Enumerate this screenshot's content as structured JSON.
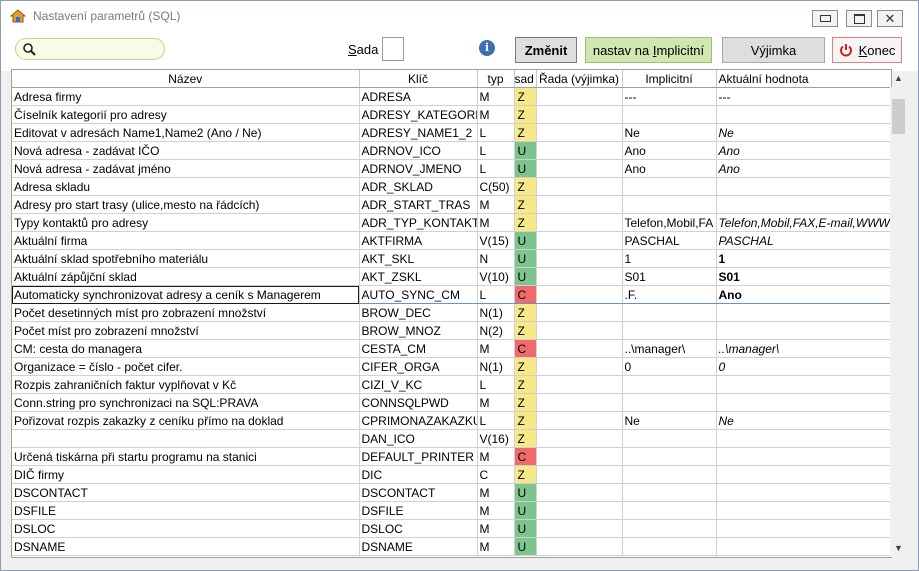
{
  "window": {
    "title": "Nastavení parametrů (SQL)"
  },
  "toolbar": {
    "search_value": "",
    "sada_label_pre": "",
    "sada_label_u": "S",
    "sada_label_post": "ada",
    "sada_value": "",
    "zmenit": "Změnit",
    "implicitni_pre": "nastav na ",
    "implicitni_u": "I",
    "implicitni_post": "mplicitní",
    "vyjimka": "Výjimka",
    "konec_u": "K",
    "konec_post": "onec"
  },
  "colors": {
    "Z": "#f7e98a",
    "U": "#7ec48e",
    "C": "#f06a6a"
  },
  "columns": [
    "Název",
    "Klíč",
    "typ",
    "sad",
    "Řada (výjimka)",
    "Implicitní",
    "Aktuální hodnota"
  ],
  "rows": [
    {
      "nazev": "Adresa firmy",
      "klic": "ADRESA",
      "typ": "M",
      "sad": "Z",
      "rada": "",
      "impl": "---",
      "akt": "---",
      "akt_style": ""
    },
    {
      "nazev": "Číselník kategorií pro adresy",
      "klic": "ADRESY_KATEGORI",
      "typ": "M",
      "sad": "Z",
      "rada": "",
      "impl": "",
      "akt": "",
      "akt_style": ""
    },
    {
      "nazev": "Editovat v adresách Name1,Name2 (Ano / Ne)",
      "klic": "ADRESY_NAME1_2",
      "typ": "L",
      "sad": "Z",
      "rada": "",
      "impl": "Ne",
      "akt": "Ne",
      "akt_style": "it"
    },
    {
      "nazev": "Nová adresa - zadávat IČO",
      "klic": "ADRNOV_ICO",
      "typ": "L",
      "sad": "U",
      "rada": "",
      "impl": "Ano",
      "akt": "Ano",
      "akt_style": "it"
    },
    {
      "nazev": "Nová adresa - zadávat jméno",
      "klic": "ADRNOV_JMENO",
      "typ": "L",
      "sad": "U",
      "rada": "",
      "impl": "Ano",
      "akt": "Ano",
      "akt_style": "it"
    },
    {
      "nazev": "Adresa skladu",
      "klic": "ADR_SKLAD",
      "typ": "C(50)",
      "sad": "Z",
      "rada": "",
      "impl": "",
      "akt": "",
      "akt_style": ""
    },
    {
      "nazev": "Adresy pro start trasy (ulice,mesto na řádcích)",
      "klic": "ADR_START_TRAS",
      "typ": "M",
      "sad": "Z",
      "rada": "",
      "impl": "",
      "akt": "",
      "akt_style": ""
    },
    {
      "nazev": "Typy kontaktů pro adresy",
      "klic": "ADR_TYP_KONTAKT",
      "typ": "M",
      "sad": "Z",
      "rada": "",
      "impl": "Telefon,Mobil,FA",
      "akt": "Telefon,Mobil,FAX,E-mail,WWW",
      "akt_style": "it"
    },
    {
      "nazev": "Aktuální firma",
      "klic": "AKTFIRMA",
      "typ": "V(15)",
      "sad": "U",
      "rada": "",
      "impl": "PASCHAL",
      "akt": "PASCHAL",
      "akt_style": "it"
    },
    {
      "nazev": "Aktuální sklad spotřebního materiálu",
      "klic": "AKT_SKL",
      "typ": "N",
      "sad": "U",
      "rada": "",
      "impl": "1",
      "akt": "1",
      "akt_style": "b"
    },
    {
      "nazev": "Aktuální zápůjční sklad",
      "klic": "AKT_ZSKL",
      "typ": "V(10)",
      "sad": "U",
      "rada": "",
      "impl": "S01",
      "akt": "S01",
      "akt_style": "b"
    },
    {
      "nazev": "Automaticky synchronizovat adresy a ceník s Managerem",
      "klic": "AUTO_SYNC_CM",
      "typ": "L",
      "sad": "C",
      "rada": "",
      "impl": ".F.",
      "akt": "Ano",
      "akt_style": "b",
      "selected": true
    },
    {
      "nazev": "Počet desetinných míst pro zobrazení množství",
      "klic": "BROW_DEC",
      "typ": "N(1)",
      "sad": "Z",
      "rada": "",
      "impl": "",
      "akt": "",
      "akt_style": ""
    },
    {
      "nazev": "Počet míst pro zobrazení množství",
      "klic": "BROW_MNOZ",
      "typ": "N(2)",
      "sad": "Z",
      "rada": "",
      "impl": "",
      "akt": "",
      "akt_style": ""
    },
    {
      "nazev": "CM: cesta do managera",
      "klic": "CESTA_CM",
      "typ": "M",
      "sad": "C",
      "rada": "",
      "impl": "..\\manager\\",
      "akt": "..\\manager\\",
      "akt_style": "it"
    },
    {
      "nazev": "Organizace = číslo - počet cifer.",
      "klic": "CIFER_ORGA",
      "typ": "N(1)",
      "sad": "Z",
      "rada": "",
      "impl": "0",
      "akt": "0",
      "akt_style": "it"
    },
    {
      "nazev": "Rozpis zahraničních faktur vyplňovat v Kč",
      "klic": "CIZI_V_KC",
      "typ": "L",
      "sad": "Z",
      "rada": "",
      "impl": "",
      "akt": "",
      "akt_style": ""
    },
    {
      "nazev": "Conn.string pro synchronizaci na SQL:PRAVA",
      "klic": "CONNSQLPWD",
      "typ": "M",
      "sad": "Z",
      "rada": "",
      "impl": "",
      "akt": "",
      "akt_style": ""
    },
    {
      "nazev": "Pořizovat rozpis zakazky z ceníku přímo na doklad",
      "klic": "CPRIMONAZAKAZKU",
      "typ": "L",
      "sad": "Z",
      "rada": "",
      "impl": "Ne",
      "akt": "Ne",
      "akt_style": "it"
    },
    {
      "nazev": "",
      "klic": "DAN_ICO",
      "typ": "V(16)",
      "sad": "Z",
      "rada": "",
      "impl": "",
      "akt": "",
      "akt_style": ""
    },
    {
      "nazev": "Určená tiskárna při startu programu na stanici",
      "klic": "DEFAULT_PRINTER",
      "typ": "M",
      "sad": "C",
      "rada": "",
      "impl": "",
      "akt": "",
      "akt_style": ""
    },
    {
      "nazev": "DIČ firmy",
      "klic": "DIC",
      "typ": "C",
      "sad": "Z",
      "rada": "",
      "impl": "",
      "akt": "",
      "akt_style": ""
    },
    {
      "nazev": "DSCONTACT",
      "klic": "DSCONTACT",
      "typ": "M",
      "sad": "U",
      "rada": "",
      "impl": "",
      "akt": "",
      "akt_style": ""
    },
    {
      "nazev": "DSFILE",
      "klic": "DSFILE",
      "typ": "M",
      "sad": "U",
      "rada": "",
      "impl": "",
      "akt": "",
      "akt_style": ""
    },
    {
      "nazev": "DSLOC",
      "klic": "DSLOC",
      "typ": "M",
      "sad": "U",
      "rada": "",
      "impl": "",
      "akt": "",
      "akt_style": ""
    },
    {
      "nazev": "DSNAME",
      "klic": "DSNAME",
      "typ": "M",
      "sad": "U",
      "rada": "",
      "impl": "",
      "akt": "",
      "akt_style": ""
    }
  ]
}
